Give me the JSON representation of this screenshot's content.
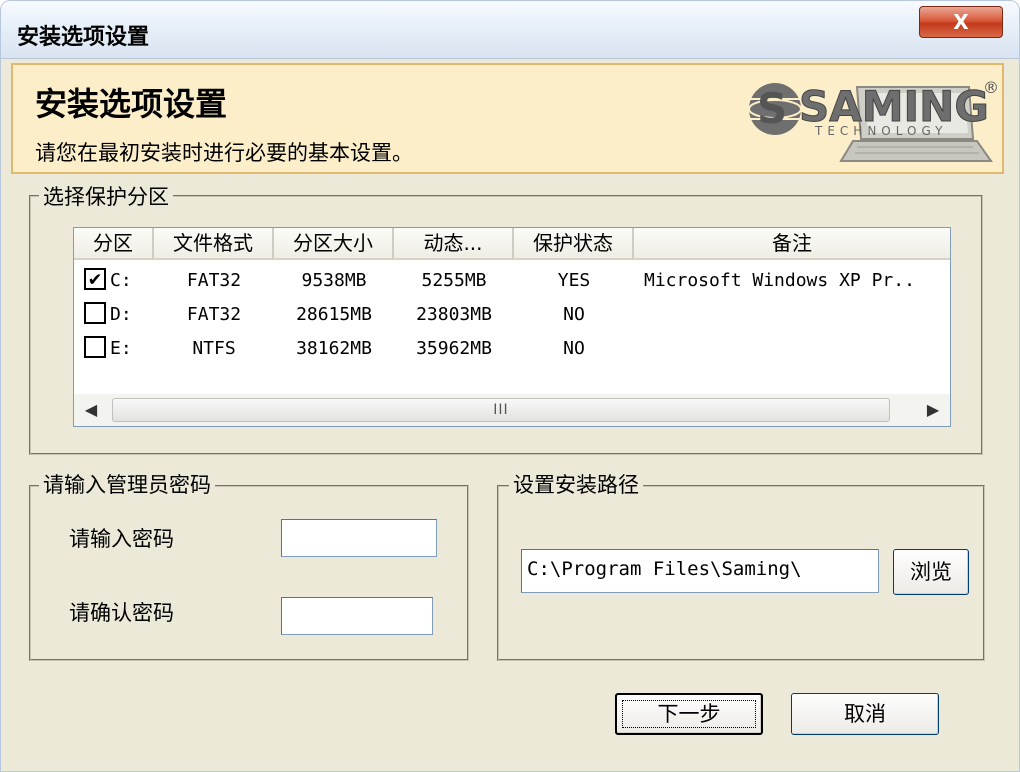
{
  "window": {
    "title": "安装选项设置",
    "close_label": "X"
  },
  "header": {
    "title": "安装选项设置",
    "subtitle": "请您在最初安装时进行必要的基本设置。",
    "logo_text": "SAMING",
    "logo_sub": "TECHNOLOGY",
    "logo_mark": "®"
  },
  "partition_group": {
    "label": "选择保护分区",
    "columns": [
      "分区",
      "文件格式",
      "分区大小",
      "动态...",
      "保护状态",
      "备注"
    ],
    "rows": [
      {
        "checked": true,
        "partition": "C:",
        "fs": "FAT32",
        "size": "9538MB",
        "dynamic": "5255MB",
        "status": "YES",
        "note": "Microsoft Windows XP Pr.."
      },
      {
        "checked": false,
        "partition": "D:",
        "fs": "FAT32",
        "size": "28615MB",
        "dynamic": "23803MB",
        "status": "NO",
        "note": ""
      },
      {
        "checked": false,
        "partition": "E:",
        "fs": "NTFS",
        "size": "38162MB",
        "dynamic": "35962MB",
        "status": "NO",
        "note": ""
      }
    ],
    "scroll_thumb_label": "III"
  },
  "password_group": {
    "label": "请输入管理员密码",
    "password_label": "请输入密码",
    "confirm_label": "请确认密码",
    "password_value": "",
    "confirm_value": ""
  },
  "path_group": {
    "label": "设置安装路径",
    "path_value": "C:\\Program Files\\Saming\\",
    "browse_label": "浏览"
  },
  "buttons": {
    "next_label": "下一步",
    "cancel_label": "取消"
  },
  "colors": {
    "window_bg": "#ece9d8",
    "header_bg": "#fbeec9",
    "header_border": "#e0b86e",
    "close_button": "#c23a1c"
  }
}
